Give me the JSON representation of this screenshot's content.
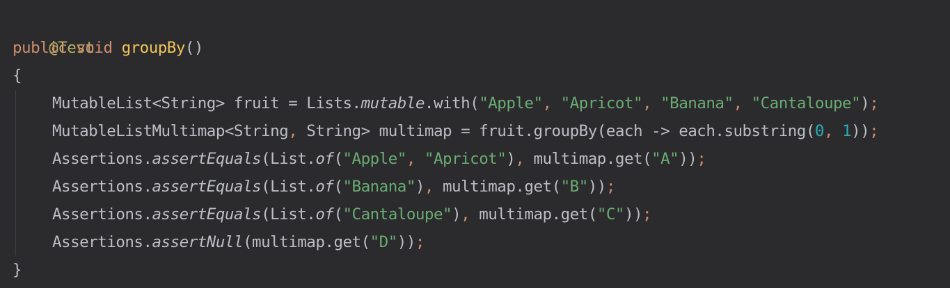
{
  "editor": {
    "lines": [
      "@Test",
      "public void groupBy()",
      "{",
      "MutableList<String> fruit = Lists.mutable.with(\"Apple\", \"Apricot\", \"Banana\", \"Cantaloupe\");",
      "MutableListMultimap<String, String> multimap = fruit.groupBy(each -> each.substring(0, 1));",
      "Assertions.assertEquals(List.of(\"Apple\", \"Apricot\"), multimap.get(\"A\"));",
      "Assertions.assertEquals(List.of(\"Banana\"), multimap.get(\"B\"));",
      "Assertions.assertEquals(List.of(\"Cantaloupe\"), multimap.get(\"C\"));",
      "Assertions.assertNull(multimap.get(\"D\"));",
      "}"
    ],
    "colors": {
      "background": "#2b2b2d",
      "annotation": "#b3ae60",
      "keyword": "#cf8e6d",
      "method_declaration": "#f0c45a",
      "string": "#6aab73",
      "number": "#2aacb8",
      "text": "#bcbec4"
    }
  }
}
